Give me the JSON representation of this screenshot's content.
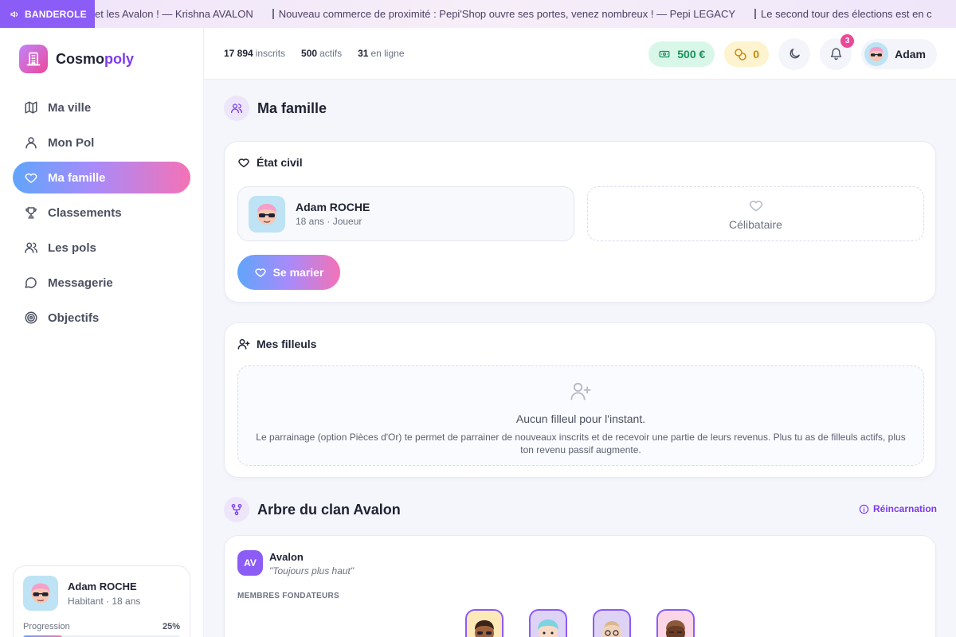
{
  "banner": {
    "tag": "BANDEROLE",
    "items": [
      "et les Avalon ! — Krishna AVALON",
      "Nouveau commerce de proximité : Pepi'Shop ouvre ses portes, venez nombreux ! — Pepi LEGACY",
      "Le second tour des élections est en c"
    ]
  },
  "app": {
    "name_part1": "Cosmo",
    "name_part2": "poly"
  },
  "nav": [
    {
      "label": "Ma ville",
      "icon": "map-icon"
    },
    {
      "label": "Mon Pol",
      "icon": "user-icon"
    },
    {
      "label": "Ma famille",
      "icon": "heart-icon",
      "active": true
    },
    {
      "label": "Classements",
      "icon": "trophy-icon"
    },
    {
      "label": "Les pols",
      "icon": "users-icon"
    },
    {
      "label": "Messagerie",
      "icon": "chat-icon"
    },
    {
      "label": "Objectifs",
      "icon": "target-icon"
    }
  ],
  "profile": {
    "name": "Adam ROCHE",
    "subtitle": "Habitant · 18 ans",
    "progress_label": "Progression",
    "progress_text": "25%",
    "progress_value": 0.25
  },
  "header": {
    "stats": [
      {
        "value": "17 894",
        "label": "inscrits"
      },
      {
        "value": "500",
        "label": "actifs"
      },
      {
        "value": "31",
        "label": "en ligne"
      }
    ],
    "money": "500 €",
    "gold": "0",
    "notifications": "3",
    "user": "Adam"
  },
  "page": {
    "title": "Ma famille",
    "civil": {
      "heading": "État civil",
      "name": "Adam ROCHE",
      "sub": "18 ans · Joueur",
      "status": "Célibataire",
      "marry_button": "Se marier"
    },
    "godchildren": {
      "heading": "Mes filleuls",
      "empty_title": "Aucun filleul pour l'instant.",
      "empty_desc": "Le parrainage (option Pièces d'Or) te permet de parrainer de nouveaux inscrits et de recevoir une partie de leurs revenus. Plus tu as de filleuls actifs, plus ton revenu passif augmente."
    },
    "clan": {
      "title": "Arbre du clan Avalon",
      "reincarnation": "Réincarnation",
      "badge": "AV",
      "name": "Avalon",
      "motto": "\"Toujours plus haut\"",
      "founders_label": "MEMBRES FONDATEURS"
    }
  },
  "colors": {
    "accent": "#7c3aed",
    "banner_tag": "#8b5cf6",
    "money": "#17925a",
    "gold": "#c98a0a",
    "badge": "#ec4899"
  }
}
